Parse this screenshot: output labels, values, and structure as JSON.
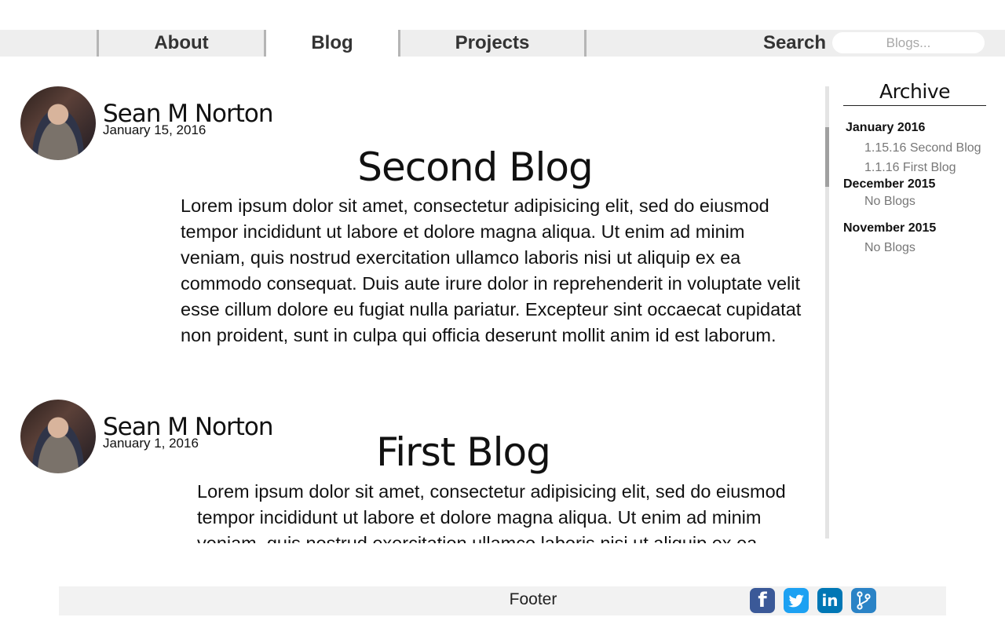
{
  "nav": {
    "tabs": [
      {
        "label": "About"
      },
      {
        "label": "Blog",
        "active": true
      },
      {
        "label": "Projects"
      }
    ],
    "search_label": "Search",
    "search_placeholder": "Blogs..."
  },
  "posts": [
    {
      "author": "Sean M Norton",
      "date": "January 15, 2016",
      "title": "Second Blog",
      "body": "Lorem ipsum dolor sit amet, consectetur adipisicing elit, sed do eiusmod tempor incididunt ut labore et dolore magna aliqua. Ut enim ad minim veniam, quis nostrud exercitation ullamco laboris nisi ut aliquip ex ea commodo consequat. Duis aute irure dolor in reprehenderit in voluptate velit esse cillum dolore eu fugiat nulla pariatur. Excepteur sint occaecat cupidatat non proident, sunt in culpa qui officia deserunt mollit anim id est laborum."
    },
    {
      "author": "Sean M Norton",
      "date": "January 1, 2016",
      "title": "First Blog",
      "body": "Lorem ipsum dolor sit amet, consectetur adipisicing elit, sed do eiusmod tempor incididunt ut labore et dolore magna aliqua. Ut enim ad minim veniam, quis nostrud exercitation ullamco laboris nisi ut aliquip ex ea"
    }
  ],
  "archive": {
    "title": "Archive",
    "months": [
      {
        "label": "January 2016",
        "items": [
          "1.15.16 Second Blog",
          "1.1.16 First Blog"
        ]
      },
      {
        "label": "December 2015",
        "items": [
          "No Blogs"
        ]
      },
      {
        "label": "November 2015",
        "items": [
          "No Blogs"
        ]
      }
    ]
  },
  "footer": {
    "label": "Footer",
    "social": [
      {
        "icon": "facebook-icon",
        "glyph": "f",
        "color": "#3b5998"
      },
      {
        "icon": "twitter-icon",
        "glyph": "t",
        "color": "#1da1f2"
      },
      {
        "icon": "linkedin-icon",
        "glyph": "in",
        "color": "#0077b5"
      },
      {
        "icon": "git-branch-icon",
        "glyph": "⑂",
        "color": "#2b83c6"
      }
    ]
  }
}
